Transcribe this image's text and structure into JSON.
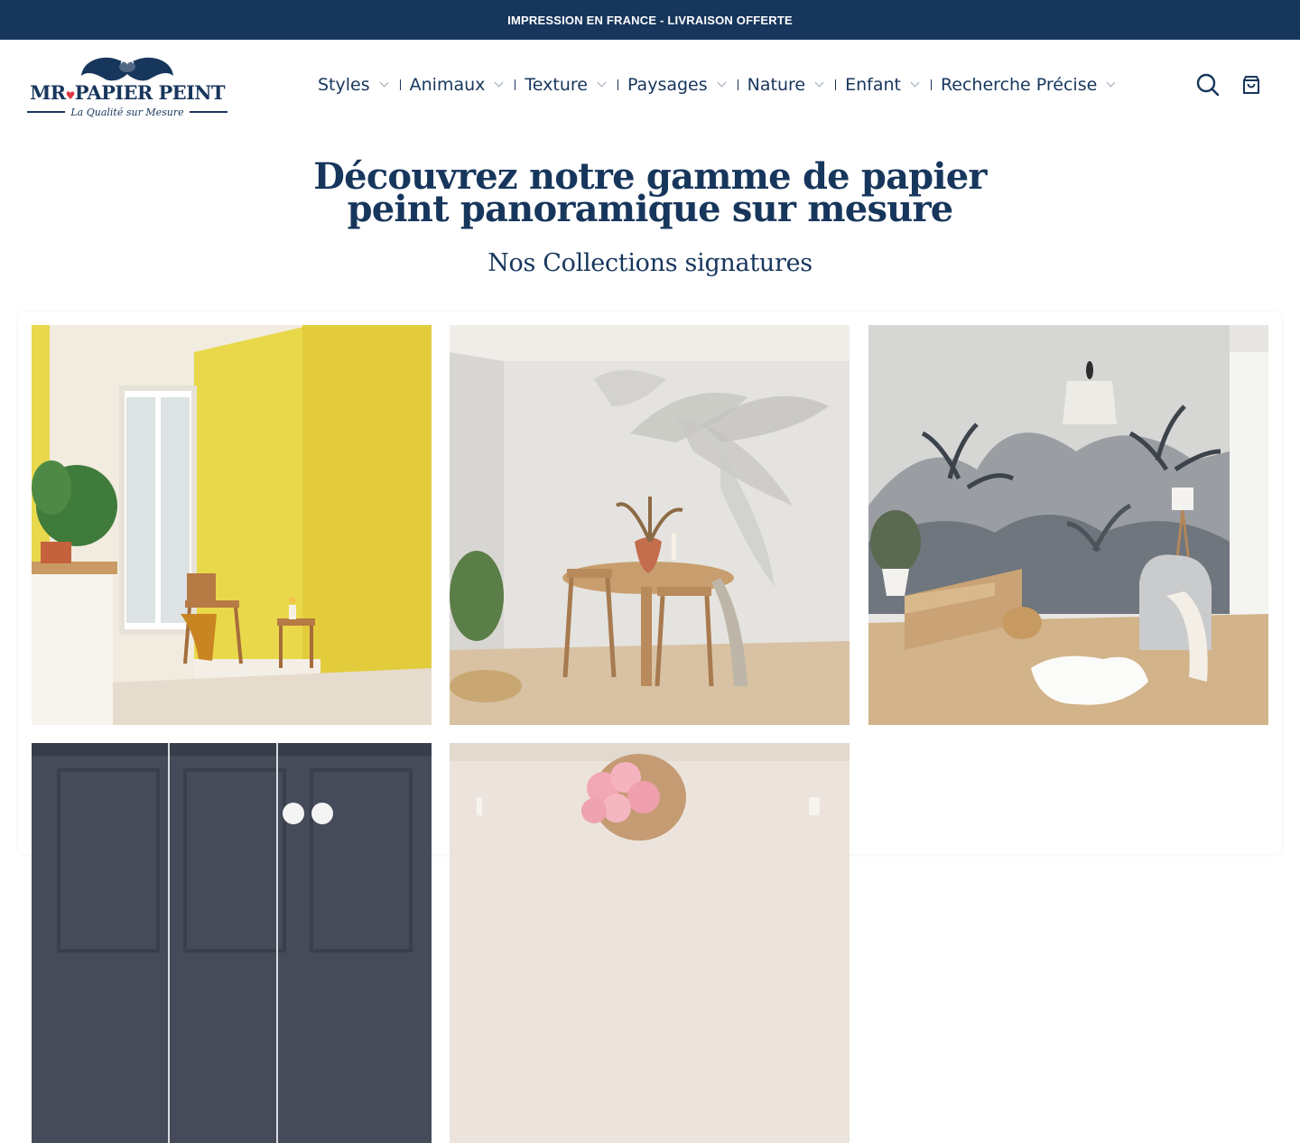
{
  "announcement": {
    "text": "IMPRESSION EN FRANCE - LIVRAISON OFFERTE"
  },
  "logo": {
    "brand": "MR PAPIER PEINT",
    "brand_left": "MR",
    "brand_right": "PAPIER PEINT",
    "tagline": "La Qualité sur Mesure"
  },
  "nav": {
    "items": [
      {
        "label": "Styles"
      },
      {
        "label": "Animaux"
      },
      {
        "label": "Texture"
      },
      {
        "label": "Paysages"
      },
      {
        "label": "Nature"
      },
      {
        "label": "Enfant"
      },
      {
        "label": "Recherche Précise"
      }
    ]
  },
  "header_icons": [
    "search-icon",
    "cart-icon"
  ],
  "hero": {
    "title_line1": "Découvrez notre gamme de papier",
    "title_line2": "peint panoramique sur mesure",
    "subtitle": "Nos Collections signatures"
  },
  "collections": [
    {
      "scene": "yellow-room-window-chair"
    },
    {
      "scene": "palm-shadow-dining-table"
    },
    {
      "scene": "jungle-toile-mural-armchair"
    },
    {
      "scene": "dark-paneled-wall"
    },
    {
      "scene": "pink-flowers-vase"
    }
  ],
  "colors": {
    "brand": "#17365c",
    "accent_heart": "#e0343f",
    "background": "#ffffff"
  }
}
